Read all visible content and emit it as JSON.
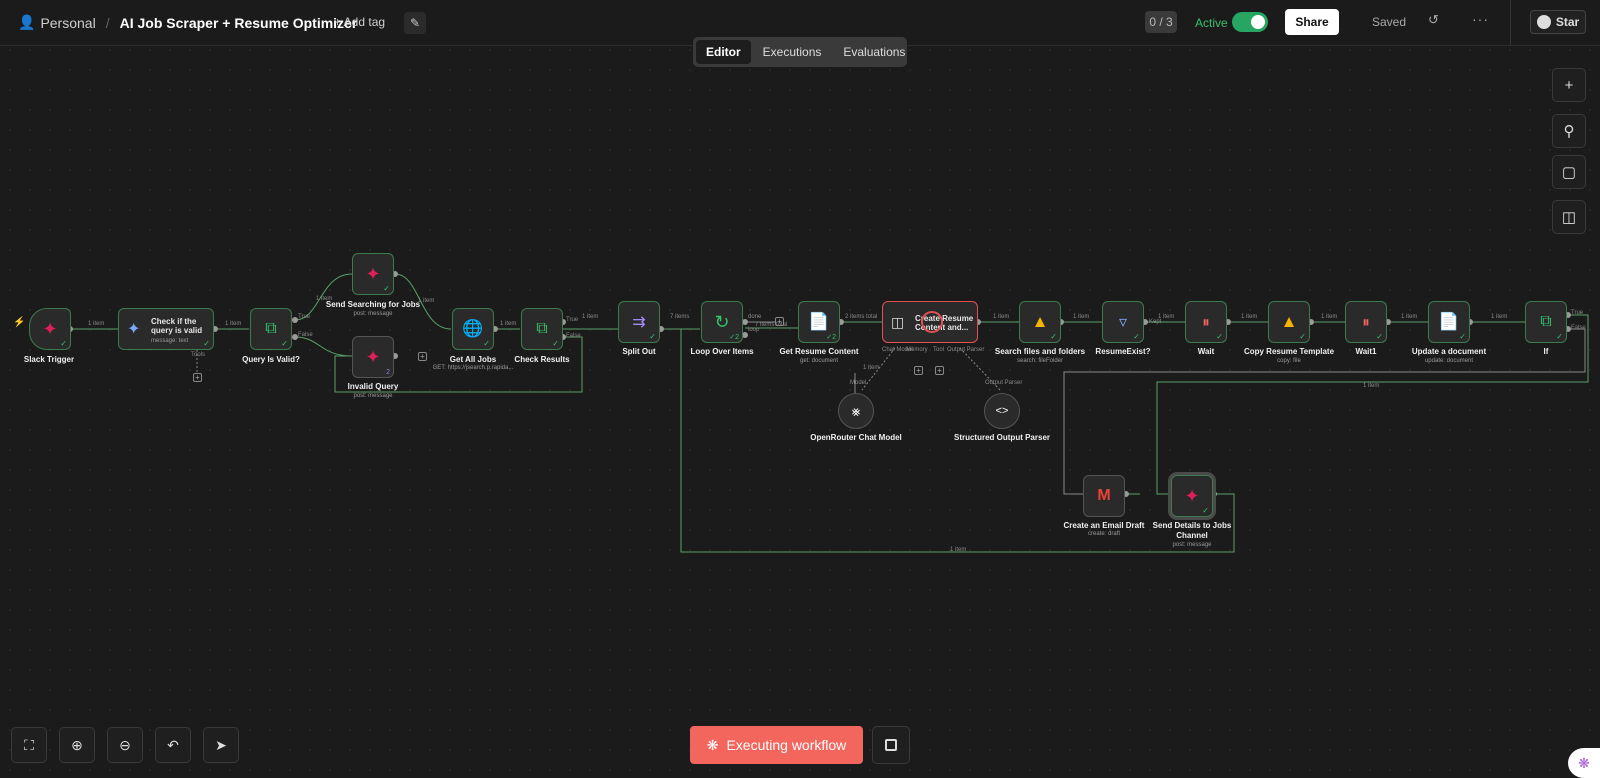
{
  "header": {
    "workspace": "Personal",
    "workflow_title": "AI Job Scraper + Resume Optimizer",
    "add_tag": "+ Add tag",
    "counter": "0 / 3",
    "active_label": "Active",
    "active": true,
    "share_label": "Share",
    "saved_label": "Saved",
    "more_label": "···",
    "star_label": "Star"
  },
  "tabs": [
    {
      "label": "Editor",
      "selected": true
    },
    {
      "label": "Executions",
      "selected": false
    },
    {
      "label": "Evaluations",
      "selected": false
    }
  ],
  "right_tools": [
    "plus-icon",
    "search-icon",
    "sticky-note-icon",
    "panel-icon"
  ],
  "bottom_tools": [
    "fit-view-icon",
    "zoom-in-icon",
    "zoom-out-icon",
    "undo-icon",
    "cursor-icon"
  ],
  "execute_button": "Executing workflow",
  "nodes": {
    "slack_trigger": {
      "label": "Slack Trigger"
    },
    "check_query": {
      "label": "Check if the query is valid",
      "sub": "message: text",
      "tools": "Tools"
    },
    "query_valid": {
      "label": "Query Is Valid?",
      "true": "True",
      "false": "False"
    },
    "send_searching": {
      "label": "Send Searching for Jobs",
      "sub": "post: message"
    },
    "invalid_query": {
      "label": "Invalid Query",
      "sub": "post: message"
    },
    "get_all_jobs": {
      "label": "Get All Jobs",
      "sub": "GET: https://jsearch.p.rapida..."
    },
    "check_results": {
      "label": "Check Results",
      "true": "True",
      "false": "False"
    },
    "split_out": {
      "label": "Split Out"
    },
    "loop_over": {
      "label": "Loop Over Items",
      "done": "done",
      "loop": "loop"
    },
    "get_resume": {
      "label": "Get Resume Content",
      "sub": "get: document"
    },
    "create_resume": {
      "label": "Create Resume Content and...",
      "chat_model": "Chat Model",
      "memory": "Memory",
      "tool": "Tool",
      "output_parser": "Output Parser"
    },
    "openrouter": {
      "label": "OpenRouter Chat Model",
      "port": "Model"
    },
    "structured_parser": {
      "label": "Structured Output Parser",
      "port": "Output Parser"
    },
    "search_files": {
      "label": "Search files and folders",
      "sub": "search: fileFolder"
    },
    "resume_exist": {
      "label": "ResumeExist?",
      "kept": "Kept"
    },
    "wait": {
      "label": "Wait"
    },
    "copy_template": {
      "label": "Copy Resume Template",
      "sub": "copy: file"
    },
    "wait1": {
      "label": "Wait1"
    },
    "update_doc": {
      "label": "Update a document",
      "sub": "update: document"
    },
    "if": {
      "label": "If",
      "true": "True",
      "false": "False"
    },
    "email_draft": {
      "label": "Create an Email Draft",
      "sub": "create: draft"
    },
    "send_details": {
      "label": "Send Details to Jobs Channel",
      "sub": "post: message"
    }
  },
  "edges": {
    "e1": "1 item",
    "e2": "1 item",
    "e3": "1 item",
    "e4": "1 item",
    "e5": "1 item",
    "e6": "1 item",
    "e7": "7 items",
    "e8": "7 items total",
    "e9": "2 items total",
    "e10": "1 item",
    "e11": "1 item",
    "e12": "1 item",
    "e13": "1 item",
    "e14": "1 item",
    "e15": "1 item",
    "e16": "1 item",
    "e17": "1 item",
    "e18": "1 item",
    "e19": "1 item",
    "badge_z": "2"
  }
}
